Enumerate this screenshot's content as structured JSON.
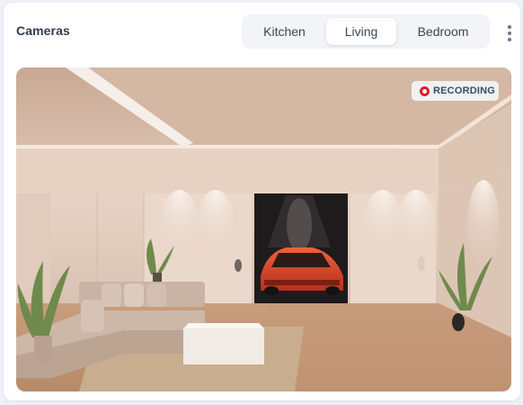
{
  "card": {
    "title": "Cameras",
    "tabs": [
      {
        "label": "Kitchen",
        "active": false
      },
      {
        "label": "Living",
        "active": true
      },
      {
        "label": "Bedroom",
        "active": false
      }
    ],
    "menu_icon": "kebab-menu-icon"
  },
  "feed": {
    "status_label": "RECORDING",
    "status_icon": "record-dot-icon",
    "status_color": "#e11d2a"
  },
  "colors": {
    "card_bg": "#ffffff",
    "page_bg": "#eef1f6",
    "tab_track": "#f2f4f8",
    "text_primary": "#2f3a4c"
  }
}
